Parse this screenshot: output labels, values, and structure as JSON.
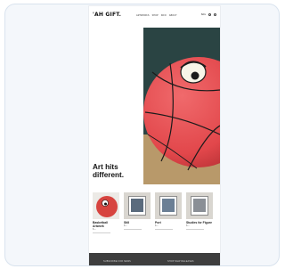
{
  "header": {
    "logo": "'AH GIFT.",
    "nav": [
      "ARTWORKS",
      "SHOP",
      "INFO",
      "ABOUT"
    ],
    "cart_label": "BAG"
  },
  "hero": {
    "headline_lines": [
      "Art hits",
      "different."
    ]
  },
  "products": [
    {
      "name": "Basketball Artwork",
      "meta": "$—",
      "accent": "#c0392b"
    },
    {
      "name": "Still",
      "meta": "$—",
      "accent": "#5a6b7d"
    },
    {
      "name": "Port",
      "meta": "$—",
      "accent": "#6b7f95"
    },
    {
      "name": "Studies for Figure",
      "meta": "$—",
      "accent": "#8a8f96"
    }
  ],
  "footer": {
    "left": "SUBSCRIBE FOR NEWS",
    "right": "SHOP NEW RELEASES"
  },
  "colors": {
    "ball": "#e2474b",
    "card_bg": "#f4f7fb",
    "footer_bg": "#3e3e3e"
  }
}
